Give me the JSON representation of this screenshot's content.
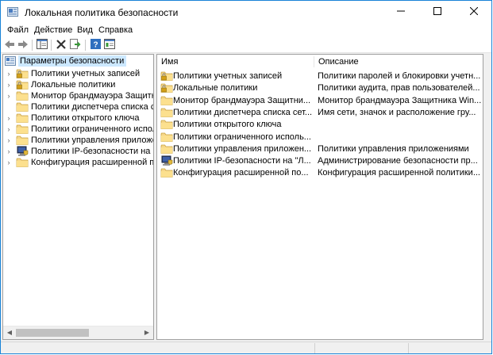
{
  "window": {
    "title": "Локальная политика безопасности",
    "controls": [
      "minimize-icon",
      "maximize-icon",
      "close-icon"
    ]
  },
  "menu": [
    {
      "label": "Файл"
    },
    {
      "label": "Действие"
    },
    {
      "label": "Вид"
    },
    {
      "label": "Справка"
    }
  ],
  "toolbar": {
    "buttons": [
      "back-icon",
      "forward-icon",
      "show-hide-tree-icon",
      "delete-icon",
      "export-list-icon",
      "help-icon",
      "properties-icon"
    ]
  },
  "tree": {
    "root": {
      "label": "Параметры безопасности",
      "icon": "security-settings-icon"
    },
    "items": [
      {
        "label": "Политики учетных записей",
        "icon": "folder-lock-icon",
        "expandable": true
      },
      {
        "label": "Локальные политики",
        "icon": "folder-lock-icon",
        "expandable": true
      },
      {
        "label": "Монитор брандмауэра Защитника Windows в режиме повышенной безопасности",
        "icon": "folder-icon",
        "expandable": true
      },
      {
        "label": "Политики диспетчера списка сетей",
        "icon": "folder-icon",
        "expandable": false
      },
      {
        "label": "Политики открытого ключа",
        "icon": "folder-icon",
        "expandable": true
      },
      {
        "label": "Политики ограниченного использования программ",
        "icon": "folder-icon",
        "expandable": true
      },
      {
        "label": "Политики управления приложениями",
        "icon": "folder-icon",
        "expandable": true
      },
      {
        "label": "Политики IP-безопасности на \"Локальный компьютер\"",
        "icon": "ip-security-icon",
        "expandable": true
      },
      {
        "label": "Конфигурация расширенной политики аудита",
        "icon": "folder-icon",
        "expandable": true
      }
    ]
  },
  "list": {
    "columns": {
      "name": "Имя",
      "description": "Описание"
    },
    "rows": [
      {
        "name": "Политики учетных записей",
        "description": "Политики паролей и блокировки учетных записей",
        "icon": "folder-lock-icon"
      },
      {
        "name": "Локальные политики",
        "description": "Политики аудита, прав пользователей и параметров безопасности",
        "icon": "folder-lock-icon"
      },
      {
        "name": "Монитор брандмауэра Защитника Windows в режиме повышенной безопасности",
        "description": "Монитор брандмауэра Защитника Windows в режиме повышенной безопасности",
        "icon": "folder-icon"
      },
      {
        "name": "Политики диспетчера списка сетей",
        "description": "Имя сети, значок и расположение групповых политик",
        "icon": "folder-icon"
      },
      {
        "name": "Политики открытого ключа",
        "description": "",
        "icon": "folder-icon"
      },
      {
        "name": "Политики ограниченного использования программ",
        "description": "",
        "icon": "folder-icon"
      },
      {
        "name": "Политики управления приложениями",
        "description": "Политики управления приложениями",
        "icon": "folder-icon"
      },
      {
        "name": "Политики IP-безопасности на \"Локальный компьютер\"",
        "description": "Администрирование безопасности протокола IP",
        "icon": "ip-security-icon"
      },
      {
        "name": "Конфигурация расширенной политики аудита",
        "description": "Конфигурация расширенной политики аудита",
        "icon": "folder-icon"
      }
    ]
  }
}
